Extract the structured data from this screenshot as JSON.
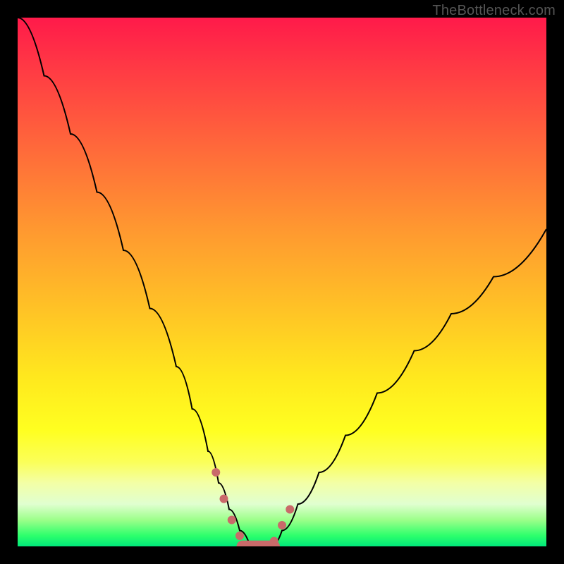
{
  "watermark": {
    "text": "TheBottleneck.com"
  },
  "chart_data": {
    "type": "line",
    "title": "",
    "xlabel": "",
    "ylabel": "",
    "xlim": [
      0,
      100
    ],
    "ylim": [
      0,
      100
    ],
    "grid": false,
    "legend": false,
    "background_gradient": {
      "top": "#ff1a4a",
      "upper_mid": "#ff9830",
      "mid": "#ffe81e",
      "lower_mid": "#fbff58",
      "bottom": "#00e87a"
    },
    "series": [
      {
        "name": "bottleneck-curve",
        "color": "#000000",
        "x": [
          0,
          5,
          10,
          15,
          20,
          25,
          30,
          33,
          36,
          38,
          40,
          42,
          44,
          46,
          48,
          50,
          53,
          57,
          62,
          68,
          75,
          82,
          90,
          100
        ],
        "values": [
          100,
          89,
          78,
          67,
          56,
          45,
          34,
          26,
          18,
          12,
          7,
          3,
          0,
          0,
          0,
          3,
          8,
          14,
          21,
          29,
          37,
          44,
          51,
          60
        ]
      }
    ],
    "markers": {
      "color": "#c96a6a",
      "dot_radius_pct": 0.8,
      "dots": [
        {
          "x": 37.5,
          "y": 14
        },
        {
          "x": 39.0,
          "y": 9
        },
        {
          "x": 40.5,
          "y": 5
        },
        {
          "x": 42.0,
          "y": 2
        },
        {
          "x": 48.5,
          "y": 1
        },
        {
          "x": 50.0,
          "y": 4
        },
        {
          "x": 51.5,
          "y": 7
        }
      ],
      "flat_segment": {
        "x_start": 42.5,
        "x_end": 48.5,
        "y": 0,
        "thickness_pct": 2.2
      }
    }
  }
}
